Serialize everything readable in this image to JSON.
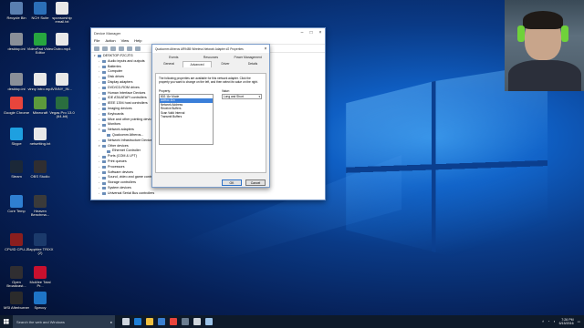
{
  "desktop": {
    "icons": [
      {
        "label": "Recycle Bin",
        "icon": "recycle-bin-icon",
        "color": "#5a7fb0"
      },
      {
        "label": "NCH Suite",
        "icon": "nch-suite-icon",
        "color": "#2b6fb8"
      },
      {
        "label": "sponsorship email.txt",
        "icon": "text-file-icon",
        "color": "#e8e8e8"
      },
      {
        "label": "desktop.ini",
        "icon": "ini-file-icon",
        "color": "#8a8f98"
      },
      {
        "label": "VideoPad Video Editor",
        "icon": "videopad-icon",
        "color": "#27a63f"
      },
      {
        "label": "Outro.mp4",
        "icon": "video-file-icon",
        "color": "#e8e8e8"
      },
      {
        "label": "desktop.ini",
        "icon": "ini-file-icon",
        "color": "#8a8f98"
      },
      {
        "label": "vinny intro.mp4",
        "icon": "video-file-icon",
        "color": "#e8e8e8"
      },
      {
        "label": "VINNY_IN...",
        "icon": "video-file-icon",
        "color": "#e8e8e8"
      },
      {
        "label": "Google Chrome",
        "icon": "chrome-icon",
        "color": "#e8453c"
      },
      {
        "label": "Minecraft",
        "icon": "minecraft-icon",
        "color": "#5c9a3c"
      },
      {
        "label": "Vegas Pro 13.0 (64-bit)",
        "icon": "vegas-pro-icon",
        "color": "#2a6e3f"
      },
      {
        "label": "Skype",
        "icon": "skype-icon",
        "color": "#1ea0e0"
      },
      {
        "label": "netsetting.txt",
        "icon": "text-file-icon",
        "color": "#e8e8e8"
      },
      {
        "label": "Steam",
        "icon": "steam-icon",
        "color": "#1b2838"
      },
      {
        "label": "OBS Studio",
        "icon": "obs-icon",
        "color": "#302e31"
      },
      {
        "label": "Core Temp",
        "icon": "core-temp-icon",
        "color": "#2f7fd1"
      },
      {
        "label": "Heaven Benchma...",
        "icon": "heaven-benchmark-icon",
        "color": "#3a3a3a"
      },
      {
        "label": "CPUID CPU-Z",
        "icon": "cpu-z-icon",
        "color": "#8a1e1e"
      },
      {
        "label": "Sapphire TRIXX (2)",
        "icon": "sapphire-trixx-icon",
        "color": "#1b3a6b"
      },
      {
        "label": "Open Broadcast...",
        "icon": "open-broadcaster-icon",
        "color": "#302e31"
      },
      {
        "label": "McAfee Total Pr...",
        "icon": "mcafee-icon",
        "color": "#c8102e"
      },
      {
        "label": "MSI Afterburner",
        "icon": "msi-afterburner-icon",
        "color": "#2b2b2b"
      },
      {
        "label": "Speccy",
        "icon": "speccy-icon",
        "color": "#1e74c6"
      }
    ]
  },
  "device_manager": {
    "title": "Device Manager",
    "controls": {
      "minimize": "–",
      "maximize": "□",
      "close": "×"
    },
    "menu": [
      "File",
      "Action",
      "View",
      "Help"
    ],
    "tree": [
      {
        "label": "DESKTOP-F2CJTG",
        "level": 0,
        "toggle": "▾"
      },
      {
        "label": "Audio inputs and outputs",
        "level": 1,
        "toggle": "›"
      },
      {
        "label": "Batteries",
        "level": 1,
        "toggle": "›"
      },
      {
        "label": "Computer",
        "level": 1,
        "toggle": "›"
      },
      {
        "label": "Disk drives",
        "level": 1,
        "toggle": "›"
      },
      {
        "label": "Display adapters",
        "level": 1,
        "toggle": "›"
      },
      {
        "label": "DVD/CD-ROM drives",
        "level": 1,
        "toggle": "›"
      },
      {
        "label": "Human Interface Devices",
        "level": 1,
        "toggle": "›"
      },
      {
        "label": "IDE ATA/ATAPI controllers",
        "level": 1,
        "toggle": "›"
      },
      {
        "label": "IEEE 1394 host controllers",
        "level": 1,
        "toggle": "›"
      },
      {
        "label": "Imaging devices",
        "level": 1,
        "toggle": "›"
      },
      {
        "label": "Keyboards",
        "level": 1,
        "toggle": "›"
      },
      {
        "label": "Mice and other pointing devices",
        "level": 1,
        "toggle": "›"
      },
      {
        "label": "Monitors",
        "level": 1,
        "toggle": "›"
      },
      {
        "label": "Network adapters",
        "level": 1,
        "toggle": "▾"
      },
      {
        "label": "Qualcomm Atheros...",
        "level": 2,
        "toggle": ""
      },
      {
        "label": "Network Infrastructure Devices",
        "level": 1,
        "toggle": "›"
      },
      {
        "label": "Other devices",
        "level": 1,
        "toggle": "▾"
      },
      {
        "label": "Ethernet Controller",
        "level": 2,
        "toggle": ""
      },
      {
        "label": "Ports (COM & LPT)",
        "level": 1,
        "toggle": "›"
      },
      {
        "label": "Print queues",
        "level": 1,
        "toggle": "›"
      },
      {
        "label": "Processors",
        "level": 1,
        "toggle": "›"
      },
      {
        "label": "Software devices",
        "level": 1,
        "toggle": "›"
      },
      {
        "label": "Sound, video and game controllers",
        "level": 1,
        "toggle": "›"
      },
      {
        "label": "Storage controllers",
        "level": 1,
        "toggle": "›"
      },
      {
        "label": "System devices",
        "level": 1,
        "toggle": "›"
      },
      {
        "label": "Universal Serial Bus controllers",
        "level": 1,
        "toggle": "›"
      }
    ]
  },
  "properties_dialog": {
    "title": "Qualcomm Atheros AR9485 Wireless Network Adapter #2 Properties",
    "close": "×",
    "tabs_row1": [
      "Events",
      "Resources",
      "Power Management"
    ],
    "tabs_row2": [
      "General",
      "Advanced",
      "Driver",
      "Details"
    ],
    "active_tab": "Advanced",
    "description": "The following properties are available for this network adapter. Click the property you want to change on the left, and then select its value on the right.",
    "property_label": "Property:",
    "value_label": "Value:",
    "properties": [
      {
        "label": "802.11n Mode",
        "selected": false
      },
      {
        "label": "AdHoc 11n",
        "selected": true
      },
      {
        "label": "Network Address",
        "selected": false
      },
      {
        "label": "Receive Buffers",
        "selected": false
      },
      {
        "label": "Scan Valid Interval",
        "selected": false
      },
      {
        "label": "Transmit Buffers",
        "selected": false
      }
    ],
    "value": "Long and Short",
    "ok_label": "OK",
    "cancel_label": "Cancel"
  },
  "taskbar": {
    "search_placeholder": "Search the web and Windows",
    "pinned": [
      {
        "icon": "task-view-icon",
        "color": "#cfd6df"
      },
      {
        "icon": "edge-icon",
        "color": "#1e7fd6"
      },
      {
        "icon": "file-explorer-icon",
        "color": "#f0c040"
      },
      {
        "icon": "store-icon",
        "color": "#3a7fd0"
      },
      {
        "icon": "chrome-icon",
        "color": "#e8453c"
      },
      {
        "icon": "steam-icon",
        "color": "#6b7d90"
      },
      {
        "icon": "media-icon",
        "color": "#d0d6dc"
      },
      {
        "icon": "device-manager-icon",
        "color": "#9cc3e8"
      }
    ],
    "time": "7:26 PM",
    "date": "6/15/2016"
  }
}
